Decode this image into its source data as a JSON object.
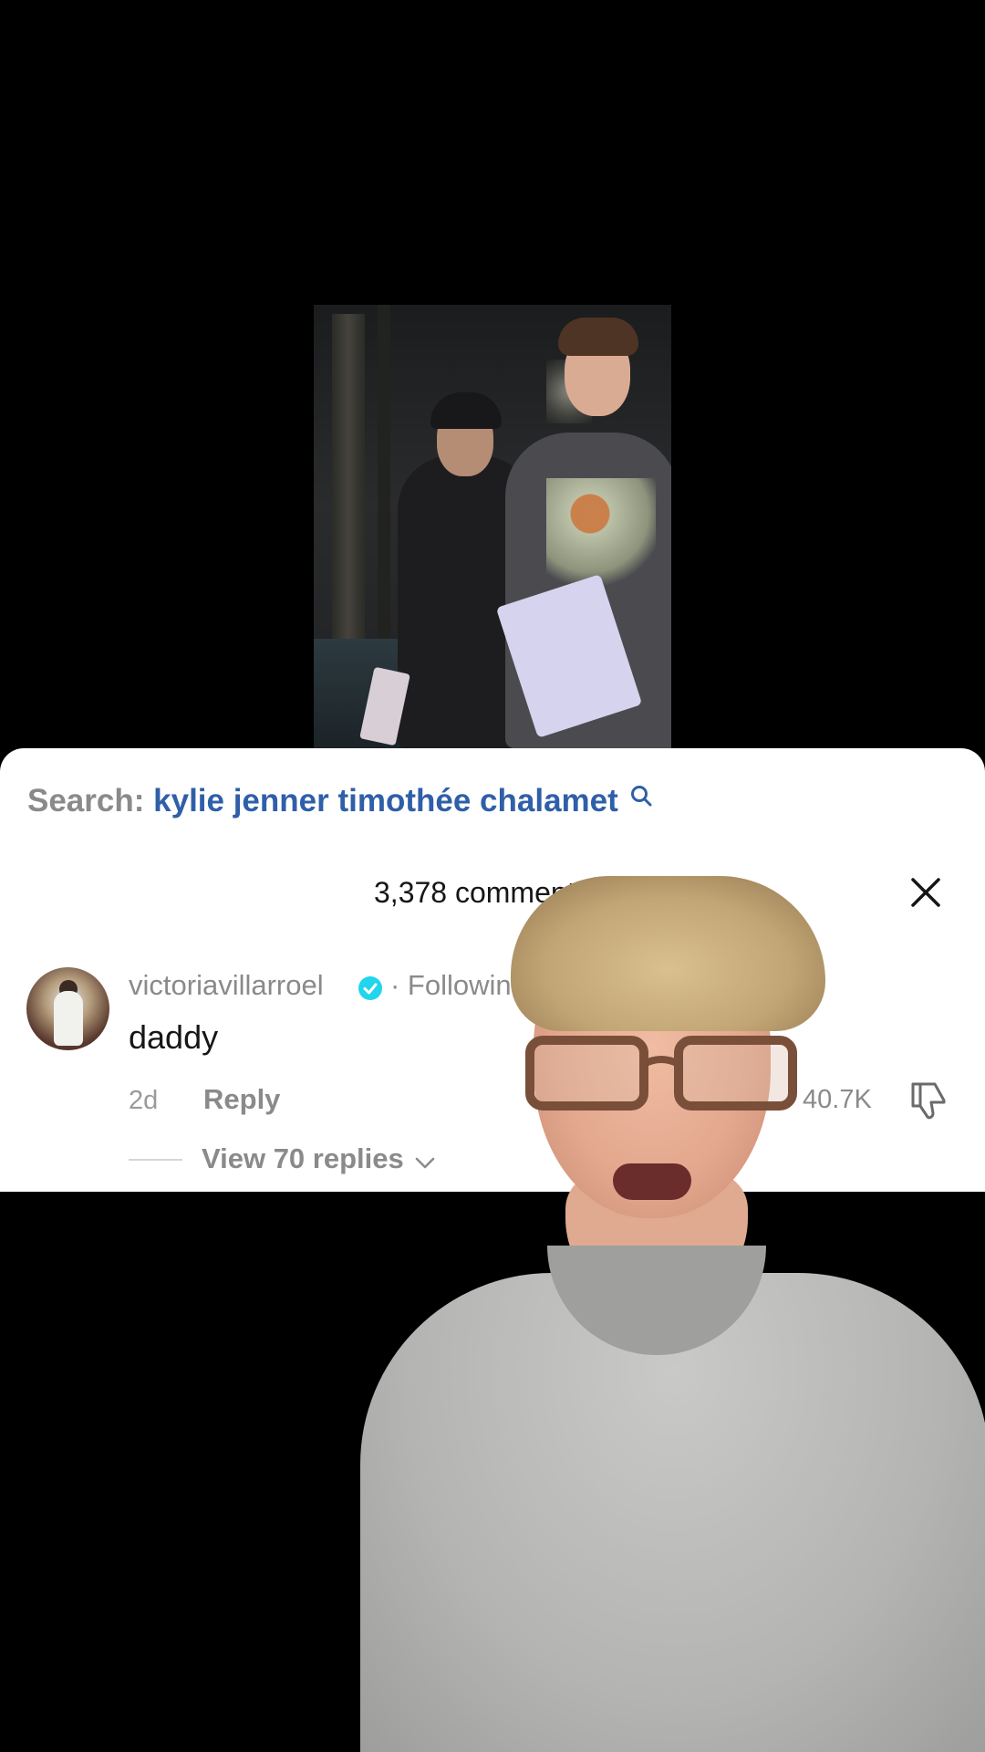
{
  "search": {
    "label": "Search:",
    "query": "kylie jenner timothée chalamet"
  },
  "comments_header": {
    "count_label": "3,378 comments"
  },
  "comment": {
    "username": "victoriavillarroel",
    "following_label": "· Following",
    "text": "daddy",
    "time": "2d",
    "reply_label": "Reply",
    "like_count": "40.7K",
    "view_replies_label": "View 70 replies"
  },
  "colors": {
    "search_term": "#2f5fa8",
    "verified_badge": "#20d5ec",
    "muted_text": "#8a8a8a"
  },
  "icons": [
    "search-icon",
    "filter-icon",
    "close-icon",
    "verified-badge-icon",
    "dislike-icon",
    "chevron-down-icon"
  ]
}
